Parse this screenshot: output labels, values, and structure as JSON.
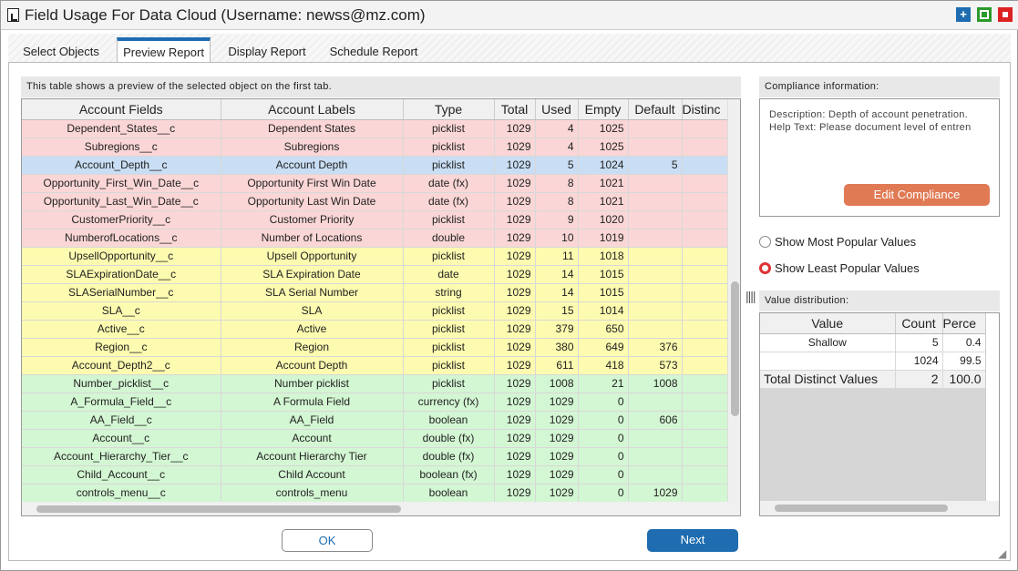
{
  "window": {
    "title": "Field Usage For Data Cloud (Username: newss@mz.com)",
    "buttons": [
      {
        "icon": "plus-icon",
        "color": "#1f6db0"
      },
      {
        "icon": "maximize-icon",
        "color": "#2a9a2a"
      },
      {
        "icon": "close-icon",
        "color": "#d22"
      }
    ]
  },
  "tabs": [
    {
      "label": "Select Objects"
    },
    {
      "label": "Preview Report",
      "active": true
    },
    {
      "label": "Display Report"
    },
    {
      "label": "Schedule Report"
    }
  ],
  "preview": {
    "caption": "This table shows a preview of the selected object on the first tab.",
    "columns": [
      "Account Fields",
      "Account Labels",
      "Type",
      "Total",
      "Used",
      "Empty",
      "Default",
      "Distinc"
    ],
    "rows": [
      [
        "Dependent_States__c",
        "Dependent States",
        "picklist",
        "1029",
        "4",
        "1025",
        "",
        "",
        "red"
      ],
      [
        "Subregions__c",
        "Subregions",
        "picklist",
        "1029",
        "4",
        "1025",
        "",
        "",
        "red"
      ],
      [
        "Account_Depth__c",
        "Account Depth",
        "picklist",
        "1029",
        "5",
        "1024",
        "5",
        "",
        "blue"
      ],
      [
        "Opportunity_First_Win_Date__c",
        "Opportunity First Win Date",
        "date (fx)",
        "1029",
        "8",
        "1021",
        "",
        "",
        "red"
      ],
      [
        "Opportunity_Last_Win_Date__c",
        "Opportunity Last Win Date",
        "date (fx)",
        "1029",
        "8",
        "1021",
        "",
        "",
        "red"
      ],
      [
        "CustomerPriority__c",
        "Customer Priority",
        "picklist",
        "1029",
        "9",
        "1020",
        "",
        "",
        "red"
      ],
      [
        "NumberofLocations__c",
        "Number of Locations",
        "double",
        "1029",
        "10",
        "1019",
        "",
        "",
        "red"
      ],
      [
        "UpsellOpportunity__c",
        "Upsell Opportunity",
        "picklist",
        "1029",
        "11",
        "1018",
        "",
        "",
        "yellow"
      ],
      [
        "SLAExpirationDate__c",
        "SLA Expiration Date",
        "date",
        "1029",
        "14",
        "1015",
        "",
        "",
        "yellow"
      ],
      [
        "SLASerialNumber__c",
        "SLA Serial Number",
        "string",
        "1029",
        "14",
        "1015",
        "",
        "",
        "yellow"
      ],
      [
        "SLA__c",
        "SLA",
        "picklist",
        "1029",
        "15",
        "1014",
        "",
        "",
        "yellow"
      ],
      [
        "Active__c",
        "Active",
        "picklist",
        "1029",
        "379",
        "650",
        "",
        "",
        "yellow"
      ],
      [
        "Region__c",
        "Region",
        "picklist",
        "1029",
        "380",
        "649",
        "376",
        "",
        "yellow"
      ],
      [
        "Account_Depth2__c",
        "Account Depth",
        "picklist",
        "1029",
        "611",
        "418",
        "573",
        "",
        "yellow"
      ],
      [
        "Number_picklist__c",
        "Number picklist",
        "picklist",
        "1029",
        "1008",
        "21",
        "1008",
        "",
        "green"
      ],
      [
        "A_Formula_Field__c",
        "A Formula Field",
        "currency (fx)",
        "1029",
        "1029",
        "0",
        "",
        "",
        "green"
      ],
      [
        "AA_Field__c",
        "AA_Field",
        "boolean",
        "1029",
        "1029",
        "0",
        "606",
        "",
        "green"
      ],
      [
        "Account__c",
        "Account",
        "double (fx)",
        "1029",
        "1029",
        "0",
        "",
        "",
        "green"
      ],
      [
        "Account_Hierarchy_Tier__c",
        "Account Hierarchy Tier",
        "double (fx)",
        "1029",
        "1029",
        "0",
        "",
        "",
        "green"
      ],
      [
        "Child_Account__c",
        "Child Account",
        "boolean (fx)",
        "1029",
        "1029",
        "0",
        "",
        "",
        "green"
      ],
      [
        "controls_menu__c",
        "controls_menu",
        "boolean",
        "1029",
        "1029",
        "0",
        "1029",
        "",
        "green"
      ]
    ]
  },
  "compliance": {
    "header": "Compliance information:",
    "description": "Description: Depth of account penetration.",
    "help": "Help Text: Please document level of entren",
    "button": "Edit Compliance",
    "button_color": "#e07a55"
  },
  "radios": [
    {
      "label": "Show Most Popular Values",
      "checked": false
    },
    {
      "label": "Show Least Popular Values",
      "checked": true
    }
  ],
  "distribution": {
    "header": "Value distribution:",
    "columns": [
      "Value",
      "Count",
      "Perce"
    ],
    "rows": [
      [
        "Shallow",
        "5",
        "0.4"
      ],
      [
        "",
        "1024",
        "99.5"
      ]
    ],
    "total": [
      "Total Distinct Values",
      "2",
      "100.0"
    ]
  },
  "footer": {
    "ok": "OK",
    "next": "Next"
  }
}
